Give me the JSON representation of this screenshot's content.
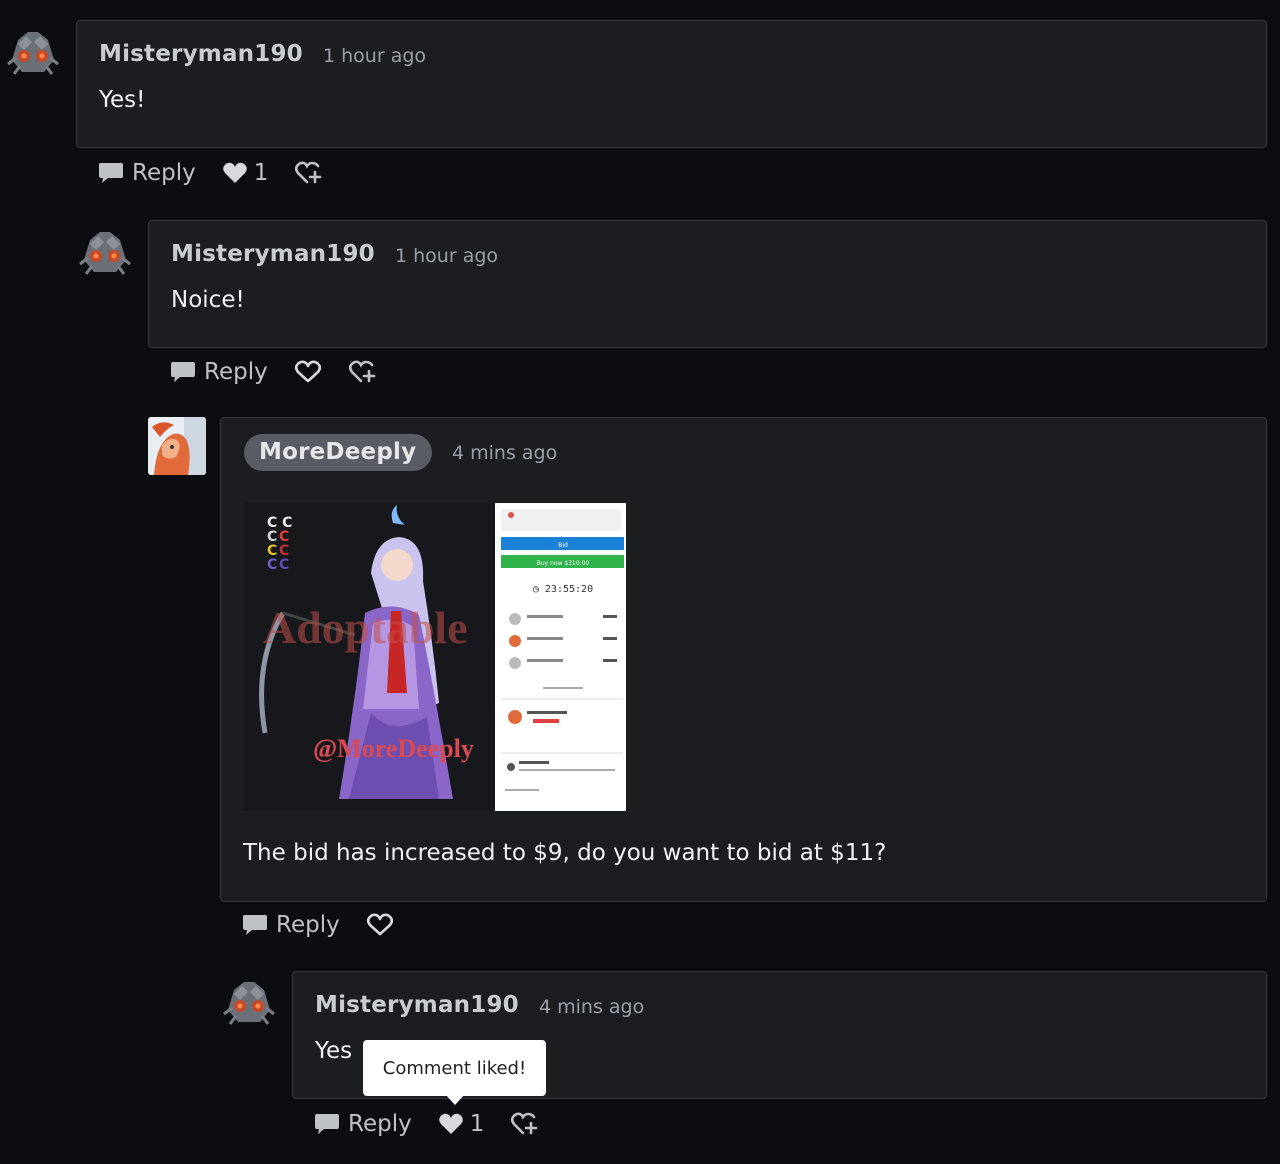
{
  "comments": [
    {
      "user": "Misteryman190",
      "time": "1 hour ago",
      "text": "Yes!",
      "reply_label": "Reply",
      "like_count": "1",
      "liked": true
    },
    {
      "user": "Misteryman190",
      "time": "1 hour ago",
      "text": "Noice!",
      "reply_label": "Reply",
      "liked": false
    },
    {
      "user": "MoreDeeply",
      "time": "4 mins ago",
      "text": "The bid has increased to $9, do you want to bid at $11?",
      "reply_label": "Reply",
      "liked": false,
      "attachment": {
        "watermark": "Adoptable",
        "handle": "@MoreDeeply",
        "timer": "23:55:20",
        "bid_button": "Bid",
        "buy_button": "Buy now $310.00"
      }
    },
    {
      "user": "Misteryman190",
      "time": "4 mins ago",
      "text": "Yes",
      "reply_label": "Reply",
      "like_count": "1",
      "liked": true
    }
  ],
  "tooltip": "Comment liked!",
  "colors": {
    "background": "#0b0d10",
    "card": "#1b1d21",
    "card_border": "#34373d",
    "badge": "#595c63",
    "bid_blue": "#1c82d8",
    "buy_green": "#2fb34a"
  },
  "icons": [
    "avatar-robot-icon",
    "comment-bubble-icon",
    "heart-icon",
    "heart-outline-icon",
    "ignite-icon"
  ]
}
